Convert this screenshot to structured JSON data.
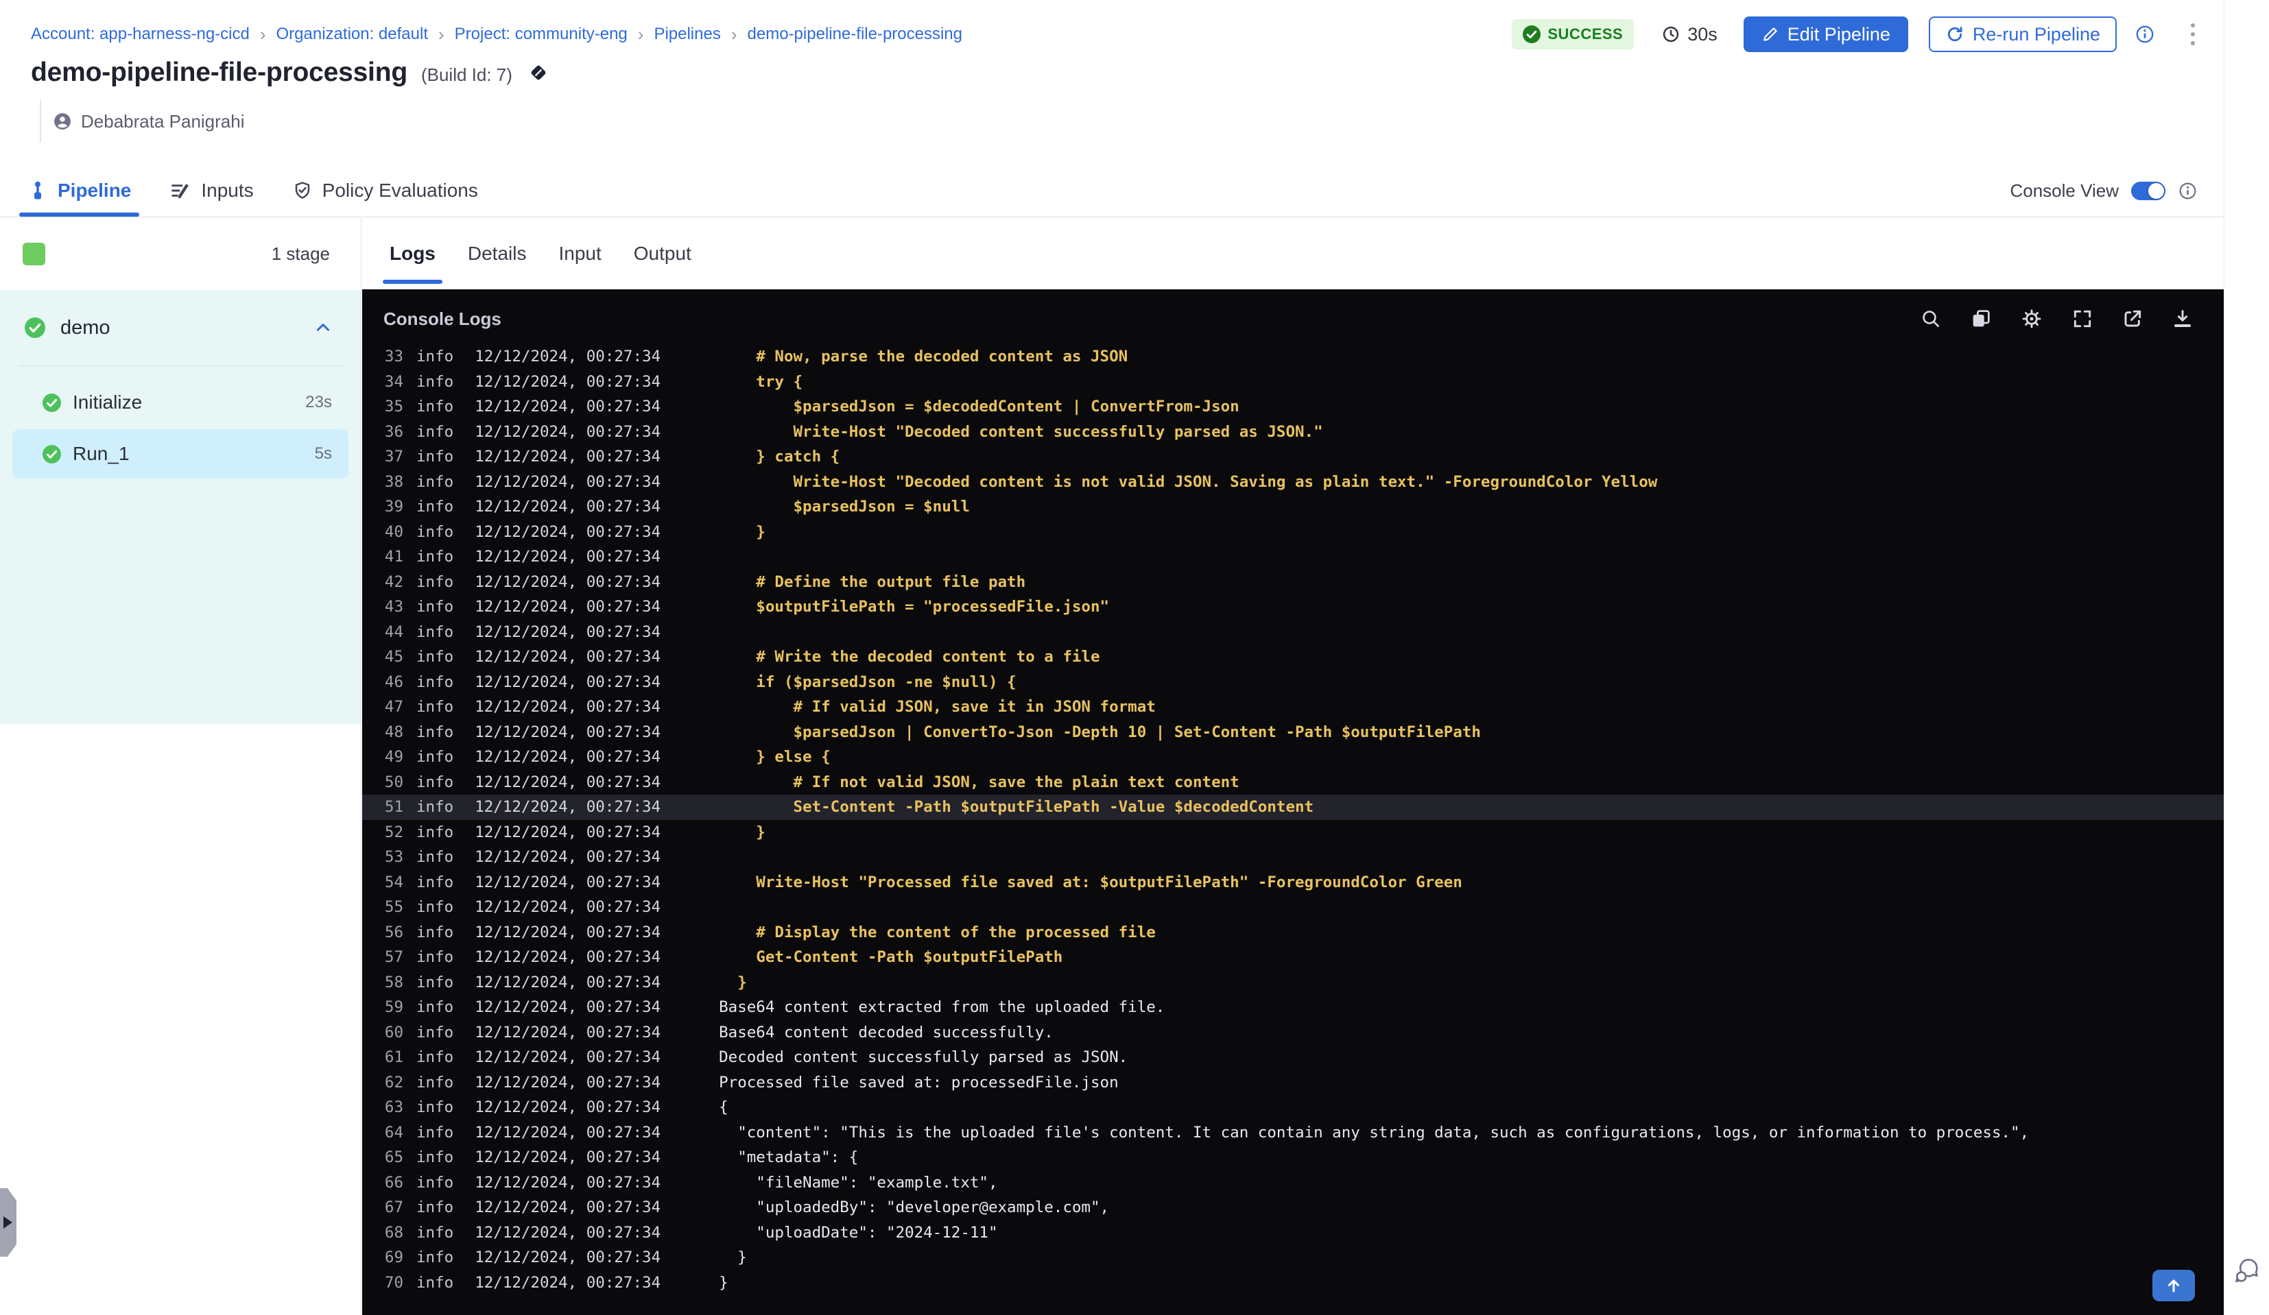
{
  "breadcrumb": {
    "items": [
      "Account: app-harness-ng-cicd",
      "Organization: default",
      "Project: community-eng",
      "Pipelines",
      "demo-pipeline-file-processing"
    ],
    "separator": "›"
  },
  "header": {
    "title": "demo-pipeline-file-processing",
    "build_label": "(Build Id: 7)",
    "author": "Debabrata Panigrahi"
  },
  "status": {
    "label": "SUCCESS",
    "duration": "30s"
  },
  "actions": {
    "edit": "Edit Pipeline",
    "rerun": "Re-run Pipeline"
  },
  "nav_tabs": [
    {
      "label": "Pipeline",
      "icon": "pipeline-icon",
      "active": true
    },
    {
      "label": "Inputs",
      "icon": "inputs-icon",
      "active": false
    },
    {
      "label": "Policy Evaluations",
      "icon": "policy-shield-icon",
      "active": false
    }
  ],
  "console_view": {
    "label": "Console View",
    "enabled": true
  },
  "sidebar": {
    "stage_count": "1 stage",
    "stage": {
      "name": "demo",
      "status": "success"
    },
    "steps": [
      {
        "name": "Initialize",
        "duration": "23s",
        "selected": false
      },
      {
        "name": "Run_1",
        "duration": "5s",
        "selected": true
      }
    ]
  },
  "log_tabs": [
    {
      "label": "Logs",
      "active": true
    },
    {
      "label": "Details",
      "active": false
    },
    {
      "label": "Input",
      "active": false
    },
    {
      "label": "Output",
      "active": false
    }
  ],
  "console": {
    "title": "Console Logs",
    "icons": [
      "search-icon",
      "copy-icon",
      "settings-gear-icon",
      "fullscreen-icon",
      "open-in-new-icon",
      "download-icon"
    ]
  },
  "logs": {
    "level": "info",
    "timestamp": "12/12/2024, 00:27:34",
    "lines": [
      {
        "n": 33,
        "tone": "code",
        "highlight": false,
        "text": "    # Now, parse the decoded content as JSON"
      },
      {
        "n": 34,
        "tone": "code",
        "highlight": false,
        "text": "    try {"
      },
      {
        "n": 35,
        "tone": "code",
        "highlight": false,
        "text": "        $parsedJson = $decodedContent | ConvertFrom-Json"
      },
      {
        "n": 36,
        "tone": "code",
        "highlight": false,
        "text": "        Write-Host \"Decoded content successfully parsed as JSON.\""
      },
      {
        "n": 37,
        "tone": "code",
        "highlight": false,
        "text": "    } catch {"
      },
      {
        "n": 38,
        "tone": "code",
        "highlight": false,
        "text": "        Write-Host \"Decoded content is not valid JSON. Saving as plain text.\" -ForegroundColor Yellow"
      },
      {
        "n": 39,
        "tone": "code",
        "highlight": false,
        "text": "        $parsedJson = $null"
      },
      {
        "n": 40,
        "tone": "code",
        "highlight": false,
        "text": "    }"
      },
      {
        "n": 41,
        "tone": "code",
        "highlight": false,
        "text": ""
      },
      {
        "n": 42,
        "tone": "code",
        "highlight": false,
        "text": "    # Define the output file path"
      },
      {
        "n": 43,
        "tone": "code",
        "highlight": false,
        "text": "    $outputFilePath = \"processedFile.json\""
      },
      {
        "n": 44,
        "tone": "code",
        "highlight": false,
        "text": ""
      },
      {
        "n": 45,
        "tone": "code",
        "highlight": false,
        "text": "    # Write the decoded content to a file"
      },
      {
        "n": 46,
        "tone": "code",
        "highlight": false,
        "text": "    if ($parsedJson -ne $null) {"
      },
      {
        "n": 47,
        "tone": "code",
        "highlight": false,
        "text": "        # If valid JSON, save it in JSON format"
      },
      {
        "n": 48,
        "tone": "code",
        "highlight": false,
        "text": "        $parsedJson | ConvertTo-Json -Depth 10 | Set-Content -Path $outputFilePath"
      },
      {
        "n": 49,
        "tone": "code",
        "highlight": false,
        "text": "    } else {"
      },
      {
        "n": 50,
        "tone": "code",
        "highlight": false,
        "text": "        # If not valid JSON, save the plain text content"
      },
      {
        "n": 51,
        "tone": "code",
        "highlight": true,
        "text": "        Set-Content -Path $outputFilePath -Value $decodedContent"
      },
      {
        "n": 52,
        "tone": "code",
        "highlight": false,
        "text": "    }"
      },
      {
        "n": 53,
        "tone": "code",
        "highlight": false,
        "text": ""
      },
      {
        "n": 54,
        "tone": "code",
        "highlight": false,
        "text": "    Write-Host \"Processed file saved at: $outputFilePath\" -ForegroundColor Green"
      },
      {
        "n": 55,
        "tone": "code",
        "highlight": false,
        "text": ""
      },
      {
        "n": 56,
        "tone": "code",
        "highlight": false,
        "text": "    # Display the content of the processed file"
      },
      {
        "n": 57,
        "tone": "code",
        "highlight": false,
        "text": "    Get-Content -Path $outputFilePath"
      },
      {
        "n": 58,
        "tone": "code",
        "highlight": false,
        "text": "  }"
      },
      {
        "n": 59,
        "tone": "output",
        "highlight": false,
        "text": "Base64 content extracted from the uploaded file."
      },
      {
        "n": 60,
        "tone": "output",
        "highlight": false,
        "text": "Base64 content decoded successfully."
      },
      {
        "n": 61,
        "tone": "output",
        "highlight": false,
        "text": "Decoded content successfully parsed as JSON."
      },
      {
        "n": 62,
        "tone": "output",
        "highlight": false,
        "text": "Processed file saved at: processedFile.json"
      },
      {
        "n": 63,
        "tone": "output",
        "highlight": false,
        "text": "{"
      },
      {
        "n": 64,
        "tone": "output",
        "highlight": false,
        "text": "  \"content\": \"This is the uploaded file's content. It can contain any string data, such as configurations, logs, or information to process.\","
      },
      {
        "n": 65,
        "tone": "output",
        "highlight": false,
        "text": "  \"metadata\": {"
      },
      {
        "n": 66,
        "tone": "output",
        "highlight": false,
        "text": "    \"fileName\": \"example.txt\","
      },
      {
        "n": 67,
        "tone": "output",
        "highlight": false,
        "text": "    \"uploadedBy\": \"developer@example.com\","
      },
      {
        "n": 68,
        "tone": "output",
        "highlight": false,
        "text": "    \"uploadDate\": \"2024-12-11\""
      },
      {
        "n": 69,
        "tone": "output",
        "highlight": false,
        "text": "  }"
      },
      {
        "n": 70,
        "tone": "output",
        "highlight": false,
        "text": "}"
      }
    ]
  },
  "colors": {
    "accent_blue": "#2f6bd8",
    "success_green": "#15801c",
    "success_bg": "#e3f6df",
    "stage_green": "#6ecb5f",
    "check_green": "#4ec15c",
    "console_bg": "#0a0a0d",
    "code_yellow": "#e9c25f",
    "output_white": "#e9eaf0",
    "highlight_row": "#23232c",
    "sidebar_teal": "#e9f6f6",
    "selected_step": "#cfeffc"
  }
}
